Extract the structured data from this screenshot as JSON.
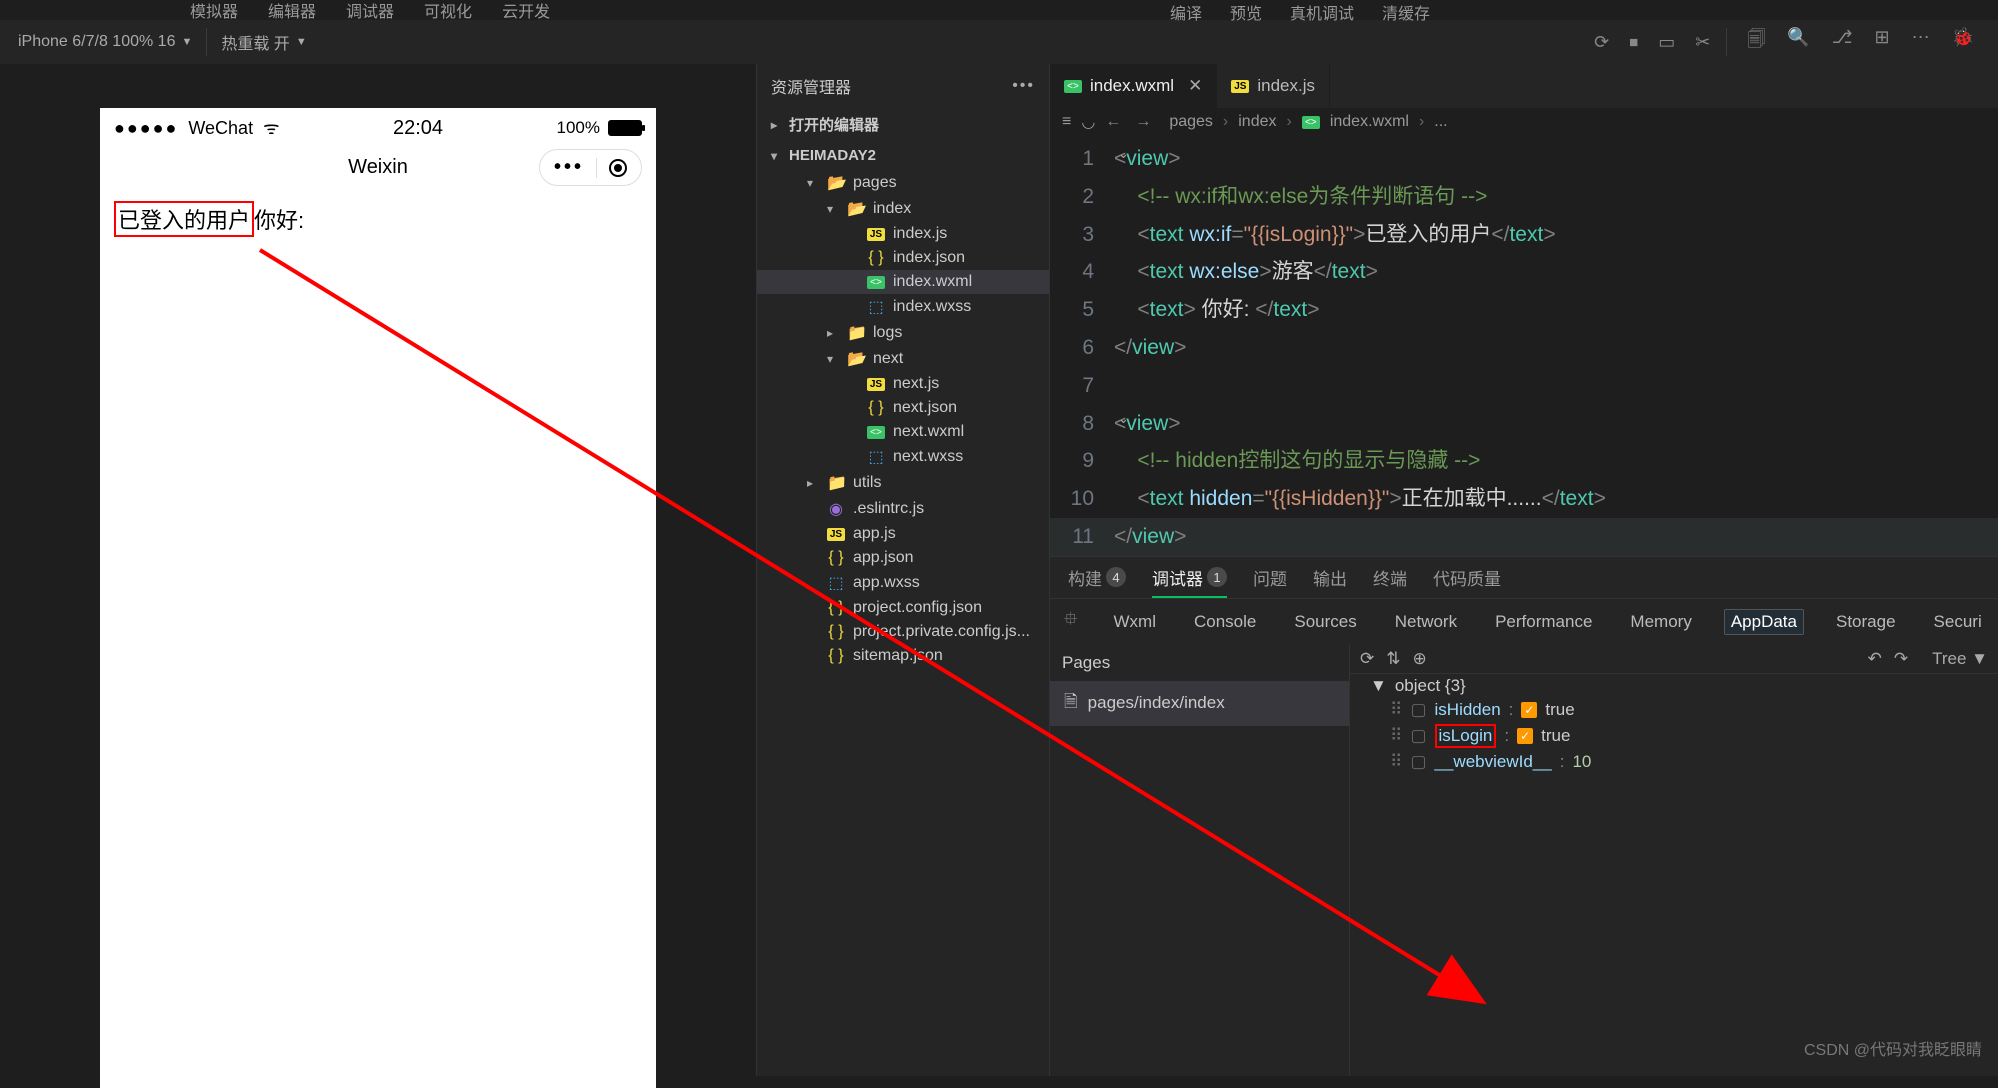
{
  "top_menu": {
    "items": [
      "模拟器",
      "编辑器",
      "调试器",
      "可视化",
      "云开发"
    ],
    "right_items": [
      "编译",
      "预览",
      "真机调试",
      "清缓存"
    ]
  },
  "toolbar": {
    "device": "iPhone 6/7/8 100% 16",
    "hot_reload": "热重载 开"
  },
  "simulator": {
    "carrier": "WeChat",
    "time": "22:04",
    "battery": "100%",
    "nav_title": "Weixin",
    "body_user": "已登入的用户",
    "body_hello": "你好:"
  },
  "explorer": {
    "title": "资源管理器",
    "sections": [
      {
        "label": "打开的编辑器",
        "open": false
      },
      {
        "label": "HEIMADAY2",
        "open": true
      }
    ],
    "tree": [
      {
        "depth": 2,
        "icon": "folder-open",
        "label": "pages",
        "chev": "▾"
      },
      {
        "depth": 3,
        "icon": "folder-open",
        "label": "index",
        "chev": "▾"
      },
      {
        "depth": 4,
        "icon": "js",
        "label": "index.js"
      },
      {
        "depth": 4,
        "icon": "json",
        "label": "index.json"
      },
      {
        "depth": 4,
        "icon": "wxml",
        "label": "index.wxml",
        "selected": true
      },
      {
        "depth": 4,
        "icon": "wxss",
        "label": "index.wxss"
      },
      {
        "depth": 3,
        "icon": "folder",
        "label": "logs",
        "chev": "▸"
      },
      {
        "depth": 3,
        "icon": "folder-open",
        "label": "next",
        "chev": "▾"
      },
      {
        "depth": 4,
        "icon": "js",
        "label": "next.js"
      },
      {
        "depth": 4,
        "icon": "json",
        "label": "next.json"
      },
      {
        "depth": 4,
        "icon": "wxml",
        "label": "next.wxml"
      },
      {
        "depth": 4,
        "icon": "wxss",
        "label": "next.wxss"
      },
      {
        "depth": 2,
        "icon": "folder",
        "label": "utils",
        "chev": "▸"
      },
      {
        "depth": 2,
        "icon": "eslint",
        "label": ".eslintrc.js"
      },
      {
        "depth": 2,
        "icon": "js",
        "label": "app.js"
      },
      {
        "depth": 2,
        "icon": "json",
        "label": "app.json"
      },
      {
        "depth": 2,
        "icon": "wxss",
        "label": "app.wxss"
      },
      {
        "depth": 2,
        "icon": "json",
        "label": "project.config.json"
      },
      {
        "depth": 2,
        "icon": "json",
        "label": "project.private.config.js..."
      },
      {
        "depth": 2,
        "icon": "json",
        "label": "sitemap.json"
      }
    ]
  },
  "editor": {
    "tabs": [
      {
        "icon": "wxml",
        "label": "index.wxml",
        "active": true,
        "close": true
      },
      {
        "icon": "js",
        "label": "index.js",
        "active": false,
        "close": false
      }
    ],
    "breadcrumb": [
      "pages",
      "index",
      "index.wxml",
      "..."
    ],
    "code": [
      {
        "n": 1,
        "html": "<span class='c-punct'>&lt;</span><span class='c-tag'>view</span><span class='c-punct'>&gt;</span>",
        "fold": true
      },
      {
        "n": 2,
        "html": "    <span class='c-cmt'>&lt;!-- wx:if和wx:else为条件判断语句 --&gt;</span>"
      },
      {
        "n": 3,
        "html": "    <span class='c-punct'>&lt;</span><span class='c-tag'>text</span> <span class='c-attr'>wx:if</span><span class='c-punct'>=</span><span class='c-str'>\"{{isLogin}}\"</span><span class='c-punct'>&gt;</span><span class='c-txt'>已登入的用户</span><span class='c-punct'>&lt;/</span><span class='c-tag'>text</span><span class='c-punct'>&gt;</span>"
      },
      {
        "n": 4,
        "html": "    <span class='c-punct'>&lt;</span><span class='c-tag'>text</span> <span class='c-attr'>wx:else</span><span class='c-punct'>&gt;</span><span class='c-txt'>游客</span><span class='c-punct'>&lt;/</span><span class='c-tag'>text</span><span class='c-punct'>&gt;</span>"
      },
      {
        "n": 5,
        "html": "    <span class='c-punct'>&lt;</span><span class='c-tag'>text</span><span class='c-punct'>&gt;</span><span class='c-txt'> 你好: </span><span class='c-punct'>&lt;/</span><span class='c-tag'>text</span><span class='c-punct'>&gt;</span>"
      },
      {
        "n": 6,
        "html": "<span class='c-punct'>&lt;/</span><span class='c-tag'>view</span><span class='c-punct'>&gt;</span>"
      },
      {
        "n": 7,
        "html": ""
      },
      {
        "n": 8,
        "html": "<span class='c-punct'>&lt;</span><span class='c-tag'>view</span><span class='c-punct'>&gt;</span>",
        "fold": true
      },
      {
        "n": 9,
        "html": "    <span class='c-cmt'>&lt;!-- hidden控制这句的显示与隐藏 --&gt;</span>"
      },
      {
        "n": 10,
        "html": "    <span class='c-punct'>&lt;</span><span class='c-tag'>text</span> <span class='c-attr'>hidden</span><span class='c-punct'>=</span><span class='c-str'>\"{{isHidden}}\"</span><span class='c-punct'>&gt;</span><span class='c-txt'>正在加载中......</span><span class='c-punct'>&lt;/</span><span class='c-tag'>text</span><span class='c-punct'>&gt;</span>"
      },
      {
        "n": 11,
        "html": "<span class='c-punct'>&lt;/</span><span class='c-tag'>view</span><span class='c-punct'>&gt;</span>",
        "hl": true
      }
    ]
  },
  "lower": {
    "tabs": [
      {
        "label": "构建",
        "badge": "4"
      },
      {
        "label": "调试器",
        "badge": "1",
        "active": true
      },
      {
        "label": "问题"
      },
      {
        "label": "输出"
      },
      {
        "label": "终端"
      },
      {
        "label": "代码质量"
      }
    ],
    "devtools_tabs": [
      "Wxml",
      "Console",
      "Sources",
      "Network",
      "Performance",
      "Memory",
      "AppData",
      "Storage",
      "Securi"
    ],
    "devtools_active": "AppData",
    "tree_mode": "Tree",
    "pages_header": "Pages",
    "pages_item": "pages/index/index",
    "object_header": "object {3}",
    "rows": [
      {
        "key": "isHidden",
        "val": "true",
        "chk": true
      },
      {
        "key": "isLogin",
        "val": "true",
        "chk": true,
        "hi": true
      },
      {
        "key": "__webviewId__",
        "val": "10",
        "chk": false
      }
    ]
  },
  "watermark": "CSDN @代码对我眨眼睛"
}
